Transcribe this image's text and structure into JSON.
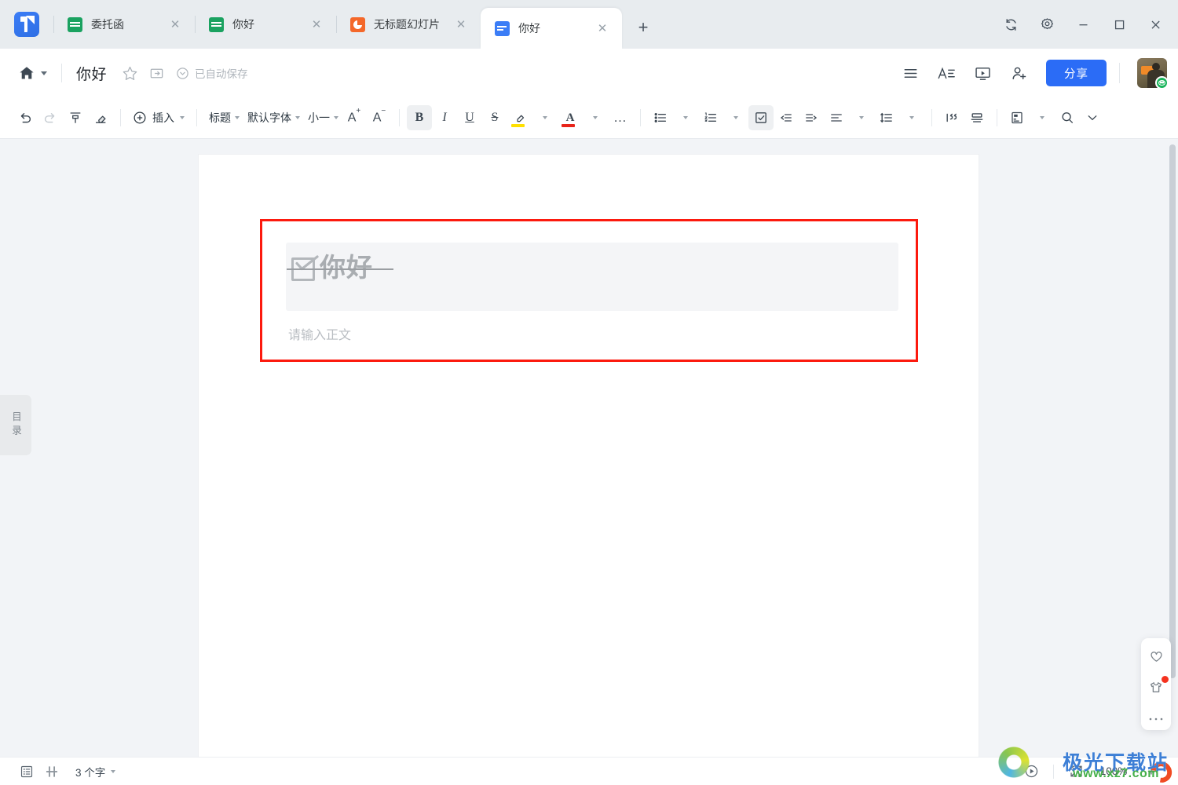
{
  "window": {
    "controls": [
      {
        "name": "sync-icon",
        "label": "同步"
      },
      {
        "name": "settings-gear-icon",
        "label": "设置"
      },
      {
        "name": "minimize-button",
        "label": "最小化"
      },
      {
        "name": "maximize-button",
        "label": "最大化"
      },
      {
        "name": "close-button",
        "label": "关闭"
      }
    ]
  },
  "tabbar": {
    "logo_label": "金山文档",
    "new_tab_label": "+",
    "close_glyph": "✕",
    "tabs": [
      {
        "title": "委托函",
        "icon": "sheet-icon",
        "type": "sheet",
        "active": false
      },
      {
        "title": "你好",
        "icon": "sheet-icon",
        "type": "sheet",
        "active": false
      },
      {
        "title": "无标题幻灯片",
        "icon": "presentation-icon",
        "type": "ppt",
        "active": false
      },
      {
        "title": "你好",
        "icon": "document-icon",
        "type": "doc",
        "active": true
      }
    ]
  },
  "header": {
    "home_label": "首页",
    "title": "你好",
    "star_label": "收藏",
    "move_label": "移动到",
    "autosave_label": "已自动保存",
    "actions": [
      {
        "name": "menu-icon",
        "label": "菜单"
      },
      {
        "name": "text-style-icon",
        "label": "文字排版"
      },
      {
        "name": "presentation-mode-icon",
        "label": "演示"
      },
      {
        "name": "add-collaborator-icon",
        "label": "邀请协作"
      }
    ],
    "share_label": "分享",
    "avatar_label": "用户头像"
  },
  "toolbar": {
    "undo_label": "撤销",
    "redo_label": "重做",
    "format_painter_label": "格式刷",
    "clear_format_label": "清除格式",
    "insert_label": "插入",
    "style_label": "标题",
    "font_label": "默认字体",
    "fontsize_label": "小一",
    "increase_font_label": "增大字号",
    "decrease_font_label": "减小字号",
    "bold_label": "B",
    "italic_label": "I",
    "underline_label": "U",
    "strikethrough_label": "S",
    "highlight_label": "突出显示",
    "fontcolor_label": "A",
    "more_label": "…",
    "bullet_list_label": "无序列表",
    "number_list_label": "有序列表",
    "checklist_label": "任务列表",
    "outdent_label": "减少缩进",
    "indent_label": "增加缩进",
    "align_label": "对齐方式",
    "linespacing_label": "行间距",
    "quote_label": "引用",
    "divider_label": "分割线",
    "pagelayout_label": "页面设置",
    "search_label": "查找替换",
    "expand_label": "展开工具栏",
    "highlight_color": "#ffe000",
    "fontcolor_color": "#e8241a"
  },
  "sidebar": {
    "toc_label": "目录"
  },
  "document": {
    "checklist_item": "你好",
    "checklist_checked": true,
    "body_placeholder": "请输入正文",
    "highlight_box_color": "#fc1a0e"
  },
  "floatpanel": {
    "items": [
      {
        "name": "favorite-heart-icon",
        "label": "收藏"
      },
      {
        "name": "skin-theme-icon",
        "label": "皮肤",
        "badge": true
      },
      {
        "name": "more-options-icon",
        "label": "更多"
      }
    ]
  },
  "statusbar": {
    "outline_label": "大纲",
    "pagemode_label": "页面模式",
    "wordcount_label": "3 个字",
    "play_label": "播放",
    "fullscreen_label": "全屏",
    "zoom_label": "100%",
    "zoomin_label": "+"
  },
  "watermark": {
    "title": "极光下载站",
    "url": "www.xz7.com"
  }
}
